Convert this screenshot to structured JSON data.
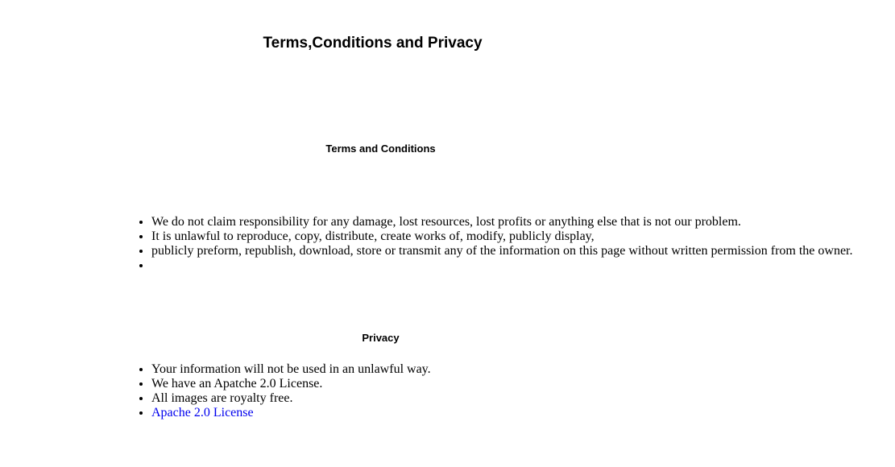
{
  "title": "Terms,Conditions and Privacy",
  "terms": {
    "heading": "Terms and Conditions",
    "items": [
      "We do not claim responsibility for any damage, lost resources, lost profits or anything else that is not our problem.",
      "It is unlawful to reproduce, copy, distribute, create works of, modify, publicly display,",
      "publicly preform, republish, download, store or transmit any of the information on this page without written permission from the owner.",
      ""
    ]
  },
  "privacy": {
    "heading": "Privacy",
    "items": [
      "Your information will not be used in an unlawful way.",
      "We have an Apatche 2.0 License.",
      "All images are royalty free."
    ],
    "link": "Apache 2.0 License"
  },
  "colors": {
    "link": "#0000ee"
  }
}
